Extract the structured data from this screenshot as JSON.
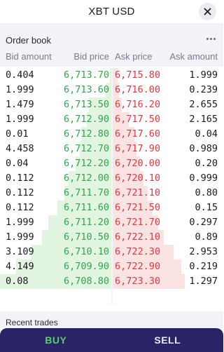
{
  "header": {
    "title": "XBT USD",
    "close_icon": "close-icon"
  },
  "order_book": {
    "label": "Order book",
    "more_icon": "more-horizontal-icon",
    "columns": {
      "bid_amount": "Bid amount",
      "bid_price": "Bid price",
      "ask_price": "Ask price",
      "ask_amount": "Ask amount"
    },
    "rows": [
      {
        "bid_amount": "0.404",
        "bid_price": "6,713.70",
        "ask_price": "6,715.80",
        "ask_amount": "1.999",
        "bid_depth": 0.01,
        "ask_depth": 0.05
      },
      {
        "bid_amount": "1.999",
        "bid_price": "6,713.60",
        "ask_price": "6,716.00",
        "ask_amount": "0.239",
        "bid_depth": 0.05,
        "ask_depth": 0.06
      },
      {
        "bid_amount": "1.479",
        "bid_price": "6,713.50",
        "ask_price": "6,716.20",
        "ask_amount": "2.655",
        "bid_depth": 0.2,
        "ask_depth": 0.09
      },
      {
        "bid_amount": "1.999",
        "bid_price": "6,712.90",
        "ask_price": "6,717.50",
        "ask_amount": "2.165",
        "bid_depth": 0.22,
        "ask_depth": 0.15
      },
      {
        "bid_amount": "0.01",
        "bid_price": "6,712.80",
        "ask_price": "6,717.60",
        "ask_amount": "0.04",
        "bid_depth": 0.27,
        "ask_depth": 0.2
      },
      {
        "bid_amount": "4.458",
        "bid_price": "6,712.70",
        "ask_price": "6,717.90",
        "ask_amount": "0.989",
        "bid_depth": 0.28,
        "ask_depth": 0.22
      },
      {
        "bid_amount": "0.04",
        "bid_price": "6,712.20",
        "ask_price": "6,720.00",
        "ask_amount": "0.20",
        "bid_depth": 0.32,
        "ask_depth": 0.25
      },
      {
        "bid_amount": "0.112",
        "bid_price": "6,712.00",
        "ask_price": "6,720.10",
        "ask_amount": "0.999",
        "bid_depth": 0.38,
        "ask_depth": 0.28
      },
      {
        "bid_amount": "0.112",
        "bid_price": "6,711.70",
        "ask_price": "6,721.10",
        "ask_amount": "0.80",
        "bid_depth": 0.42,
        "ask_depth": 0.32
      },
      {
        "bid_amount": "0.112",
        "bid_price": "6,711.60",
        "ask_price": "6,721.50",
        "ask_amount": "0.15",
        "bid_depth": 0.48,
        "ask_depth": 0.36
      },
      {
        "bid_amount": "1.999",
        "bid_price": "6,711.20",
        "ask_price": "6,721.70",
        "ask_amount": "0.297",
        "bid_depth": 0.56,
        "ask_depth": 0.41
      },
      {
        "bid_amount": "1.999",
        "bid_price": "6,710.50",
        "ask_price": "6,722.10",
        "ask_amount": "0.89",
        "bid_depth": 0.62,
        "ask_depth": 0.46
      },
      {
        "bid_amount": "3.109",
        "bid_price": "6,710.10",
        "ask_price": "6,722.30",
        "ask_amount": "2.953",
        "bid_depth": 0.72,
        "ask_depth": 0.55
      },
      {
        "bid_amount": "4.149",
        "bid_price": "6,709.90",
        "ask_price": "6,722.90",
        "ask_amount": "0.219",
        "bid_depth": 0.85,
        "ask_depth": 0.62
      },
      {
        "bid_amount": "0.08",
        "bid_price": "6,708.80",
        "ask_price": "6,723.30",
        "ask_amount": "1.297",
        "bid_depth": 1.0,
        "ask_depth": 0.65
      }
    ]
  },
  "recent_trades": {
    "label": "Recent trades"
  },
  "actions": {
    "buy_label": "BUY",
    "sell_label": "SELL"
  },
  "colors": {
    "bid_text": "#2aa84a",
    "ask_text": "#e0383e",
    "bid_bar": "#e2f5e0",
    "ask_bar": "#fbe3e3",
    "action_bar": "#2a2466",
    "buy_text": "#56d06a"
  }
}
